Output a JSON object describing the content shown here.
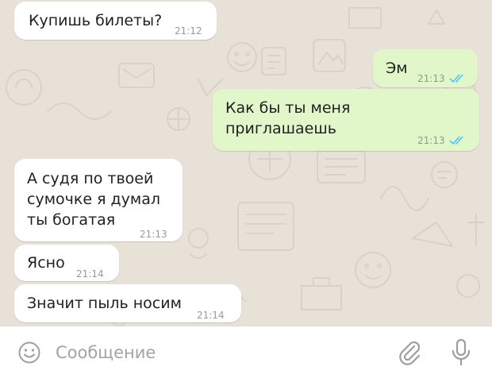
{
  "colors": {
    "chat_background": "#e7e1d7",
    "incoming_bubble": "#ffffff",
    "outgoing_bubble": "#e1f7ca",
    "read_ticks": "#4fc3f7",
    "icon_gray": "#9e9e9e"
  },
  "messages": [
    {
      "direction": "incoming",
      "text": "Купишь билеты?",
      "time": "21:12"
    },
    {
      "direction": "outgoing",
      "text": "Эм",
      "time": "21:13",
      "status": "read"
    },
    {
      "direction": "outgoing",
      "text": "Как бы ты меня\nприглашаешь",
      "time": "21:13",
      "status": "read"
    },
    {
      "direction": "incoming",
      "text": "А судя по твоей\nсумочке я думал\nты богатая",
      "time": "21:13"
    },
    {
      "direction": "incoming",
      "text": "Ясно",
      "time": "21:14"
    },
    {
      "direction": "incoming",
      "text": "Значит пыль носим",
      "time": "21:14"
    }
  ],
  "composer": {
    "placeholder": "Сообщение",
    "emoji_icon": "smiley-icon",
    "attach_icon": "paperclip-icon",
    "mic_icon": "microphone-icon"
  }
}
